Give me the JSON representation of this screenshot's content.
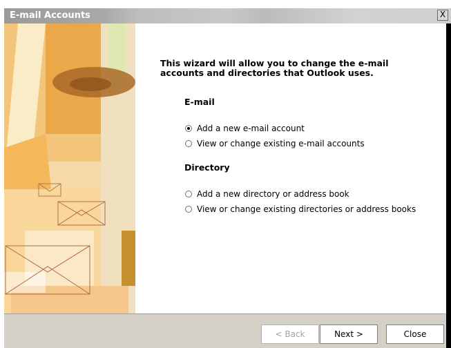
{
  "window": {
    "title": "E-mail Accounts",
    "close_glyph": "X"
  },
  "intro": "This wizard will allow you to change the e-mail accounts and directories that Outlook uses.",
  "email_section": {
    "heading": "E-mail",
    "options": [
      {
        "label": "Add a new e-mail account",
        "selected": true
      },
      {
        "label": "View or change existing e-mail accounts",
        "selected": false
      }
    ]
  },
  "directory_section": {
    "heading": "Directory",
    "options": [
      {
        "label": "Add a new directory or address book",
        "selected": false
      },
      {
        "label": "View or change existing directories or address books",
        "selected": false
      }
    ]
  },
  "buttons": {
    "back": "< Back",
    "next": "Next >",
    "close": "Close"
  },
  "colors": {
    "bottom_bar": "#d4d0c8",
    "art_orange": "#e8a63a"
  },
  "icons": {
    "close": "close-icon",
    "art": "envelope-art"
  }
}
